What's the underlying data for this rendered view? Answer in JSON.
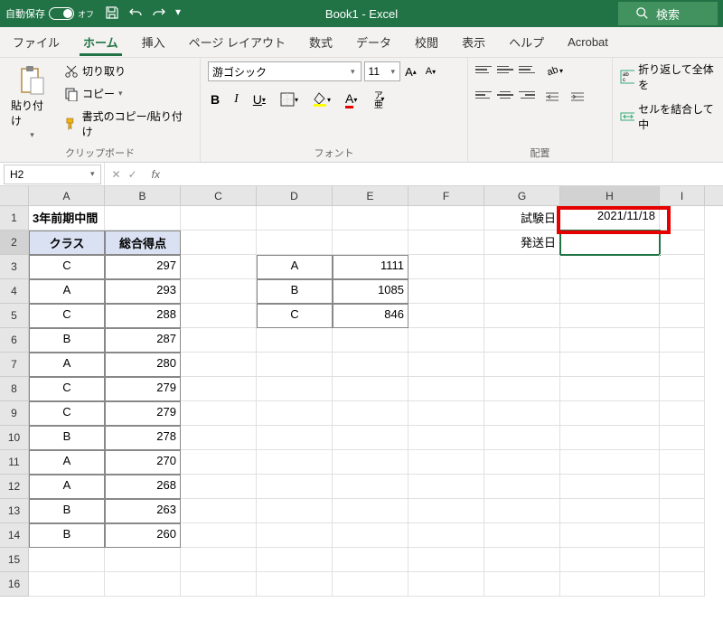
{
  "titlebar": {
    "autosave_label": "自動保存",
    "autosave_state": "オフ",
    "title": "Book1  -  Excel",
    "search_label": "検索"
  },
  "tabs": {
    "file": "ファイル",
    "home": "ホーム",
    "insert": "挿入",
    "layout": "ページ レイアウト",
    "formulas": "数式",
    "data": "データ",
    "review": "校閲",
    "view": "表示",
    "help": "ヘルプ",
    "acrobat": "Acrobat"
  },
  "ribbon": {
    "paste": "貼り付け",
    "cut": "切り取り",
    "copy": "コピー",
    "format_painter": "書式のコピー/貼り付け",
    "clipboard_label": "クリップボード",
    "font_name": "游ゴシック",
    "font_size": "11",
    "bold": "B",
    "italic": "I",
    "underline": "U",
    "phonetic": "ア亜",
    "font_label": "フォント",
    "align_label": "配置",
    "wrap": "折り返して全体を",
    "merge": "セルを結合して中"
  },
  "formula_bar": {
    "name_box": "H2",
    "fx": "fx"
  },
  "columns": [
    "A",
    "B",
    "C",
    "D",
    "E",
    "F",
    "G",
    "H",
    "I"
  ],
  "sheet": {
    "a1": "3年前期中間",
    "head_class": "クラス",
    "head_score": "総合得点",
    "rows": [
      {
        "cls": "C",
        "sc": "297"
      },
      {
        "cls": "A",
        "sc": "293"
      },
      {
        "cls": "C",
        "sc": "288"
      },
      {
        "cls": "B",
        "sc": "287"
      },
      {
        "cls": "A",
        "sc": "280"
      },
      {
        "cls": "C",
        "sc": "279"
      },
      {
        "cls": "C",
        "sc": "279"
      },
      {
        "cls": "B",
        "sc": "278"
      },
      {
        "cls": "A",
        "sc": "270"
      },
      {
        "cls": "A",
        "sc": "268"
      },
      {
        "cls": "B",
        "sc": "263"
      },
      {
        "cls": "B",
        "sc": "260"
      }
    ],
    "sum": [
      {
        "cls": "A",
        "v": "1111"
      },
      {
        "cls": "B",
        "v": "1085"
      },
      {
        "cls": "C",
        "v": "846"
      }
    ],
    "g1": "試験日",
    "g2": "発送日",
    "h1": "2021/11/18"
  }
}
